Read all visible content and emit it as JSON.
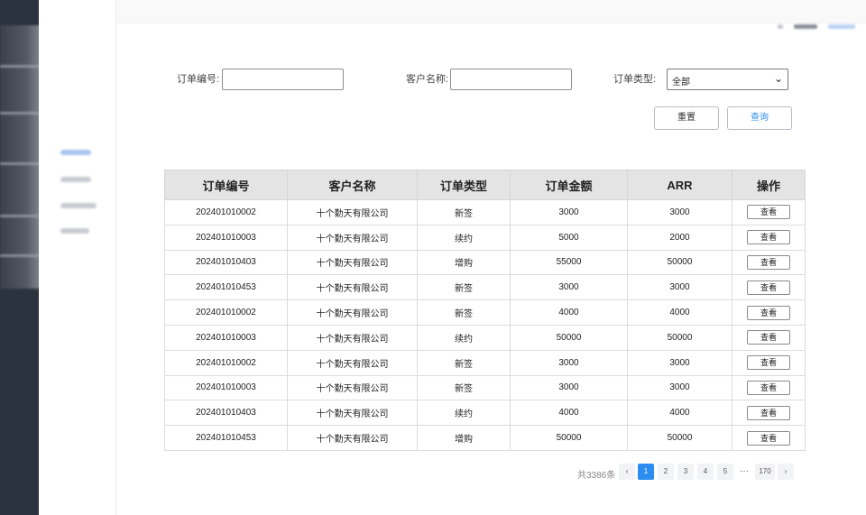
{
  "filters": {
    "order_no_label": "订单编号:",
    "customer_label": "客户名称:",
    "type_label": "订单类型:",
    "type_value": "全部",
    "reset_label": "重置",
    "search_label": "查询"
  },
  "table": {
    "headers": [
      "订单编号",
      "客户名称",
      "订单类型",
      "订单金额",
      "ARR",
      "操作"
    ],
    "action_label": "查看",
    "rows": [
      [
        "202401010002",
        "十个勤天有限公司",
        "新签",
        "3000",
        "3000"
      ],
      [
        "202401010003",
        "十个勤天有限公司",
        "续约",
        "5000",
        "2000"
      ],
      [
        "202401010403",
        "十个勤天有限公司",
        "增购",
        "55000",
        "50000"
      ],
      [
        "202401010453",
        "十个勤天有限公司",
        "新签",
        "3000",
        "3000"
      ],
      [
        "202401010002",
        "十个勤天有限公司",
        "新签",
        "4000",
        "4000"
      ],
      [
        "202401010003",
        "十个勤天有限公司",
        "续约",
        "50000",
        "50000"
      ],
      [
        "202401010002",
        "十个勤天有限公司",
        "新签",
        "3000",
        "3000"
      ],
      [
        "202401010003",
        "十个勤天有限公司",
        "新签",
        "3000",
        "3000"
      ],
      [
        "202401010403",
        "十个勤天有限公司",
        "续约",
        "4000",
        "4000"
      ],
      [
        "202401010453",
        "十个勤天有限公司",
        "增购",
        "50000",
        "50000"
      ]
    ]
  },
  "pagination": {
    "total": "共3386条",
    "prev": "‹",
    "pages": [
      "1",
      "2",
      "3",
      "4",
      "5"
    ],
    "ellipsis": "···",
    "last": "170",
    "next": "›",
    "active_color": "#2d8cf0"
  },
  "colors": {
    "rail": "#2c3340",
    "accent": "#2d8cf0",
    "header_bg": "#e4e4e4"
  }
}
